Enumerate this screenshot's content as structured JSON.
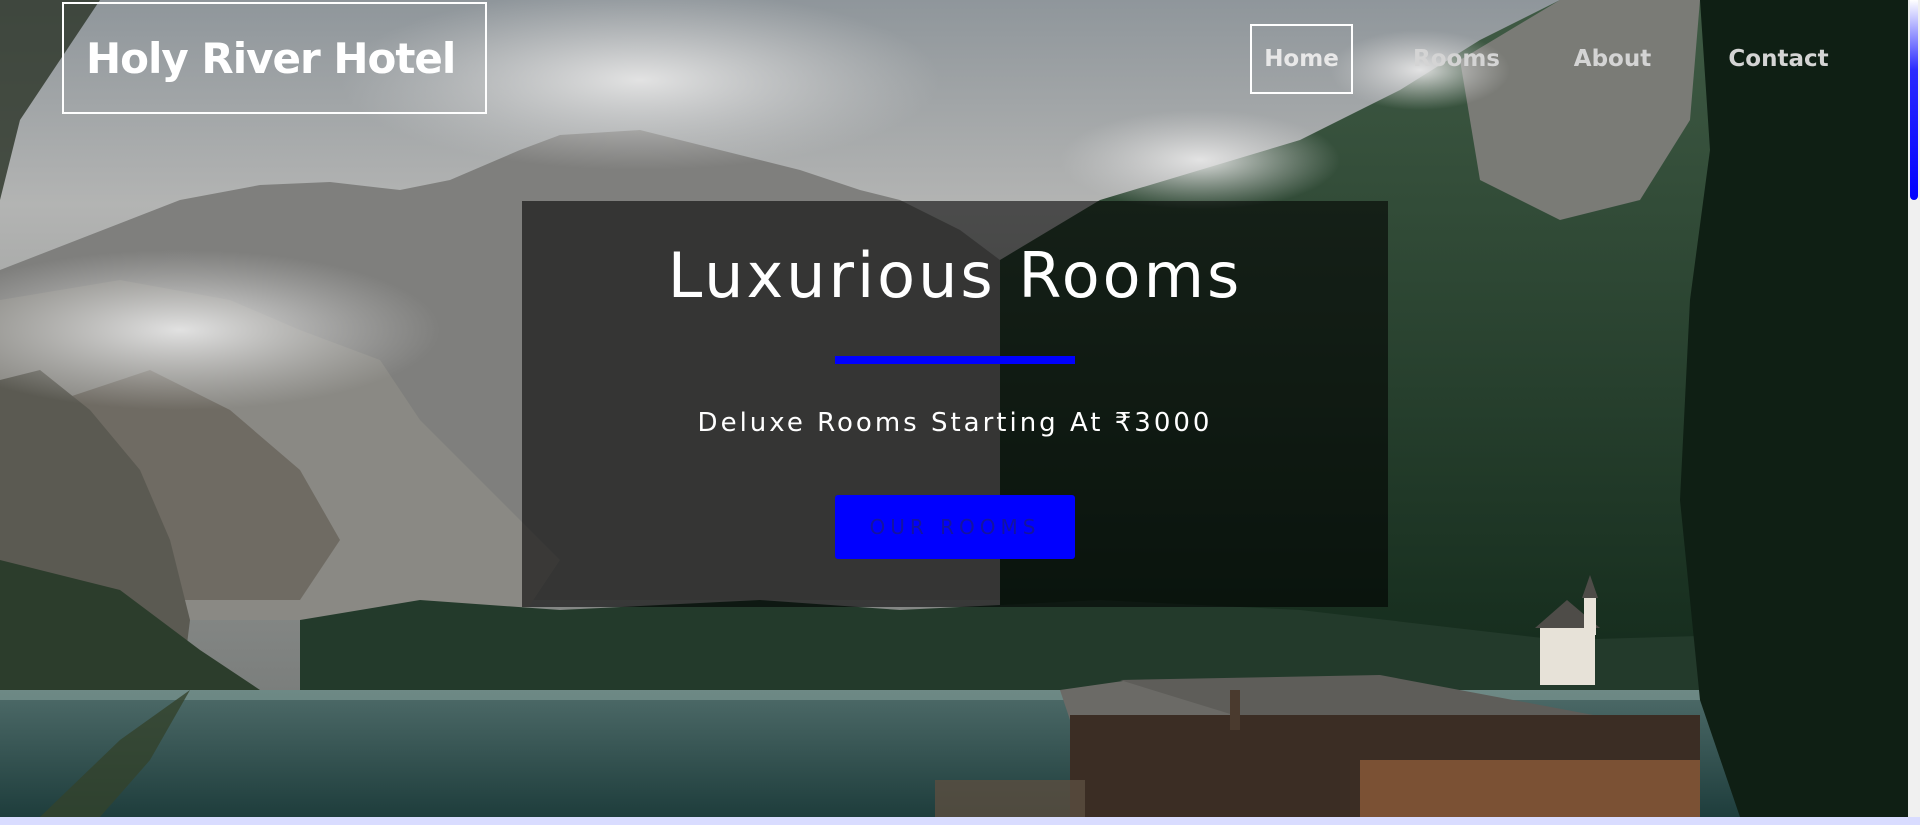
{
  "brand": {
    "name": "Holy River Hotel"
  },
  "nav": {
    "items": [
      {
        "label": "Home",
        "active": true
      },
      {
        "label": "Rooms",
        "active": false
      },
      {
        "label": "About",
        "active": false
      },
      {
        "label": "Contact",
        "active": false
      }
    ]
  },
  "hero": {
    "title": "Luxurious Rooms",
    "subtitle": "Deluxe Rooms Starting At ₹3000",
    "button_label": "OUR ROOMS",
    "background_icon": "mountain-lake-landscape-image"
  },
  "colors": {
    "accent": "#0000ff",
    "overlay": "rgba(0,0,0,0.58)",
    "nav_text": "#d4d4d4",
    "text": "#ffffff"
  }
}
